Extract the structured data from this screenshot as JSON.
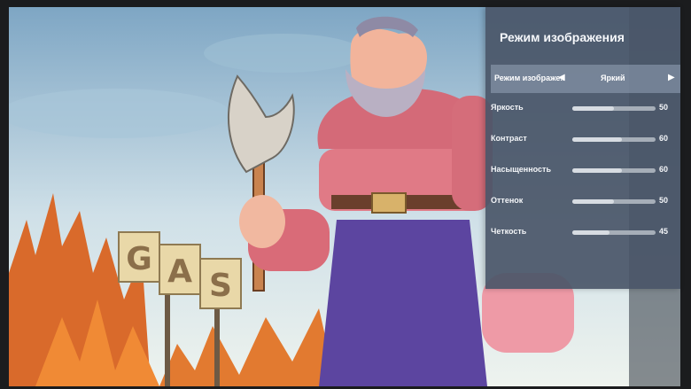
{
  "menu": {
    "title": "Режим изображения",
    "mode": {
      "label": "Режим изображе..",
      "value": "Яркий",
      "left_arrow": "◀",
      "right_arrow": "▶"
    },
    "settings": [
      {
        "label": "Яркость",
        "value": "50",
        "level": 0.5
      },
      {
        "label": "Контраст",
        "value": "60",
        "level": 0.6
      },
      {
        "label": "Насыщенность",
        "value": "60",
        "level": 0.6
      },
      {
        "label": "Оттенок",
        "value": "50",
        "level": 0.5
      },
      {
        "label": "Четкость",
        "value": "45",
        "level": 0.45
      }
    ]
  },
  "artwork": {
    "sign_letters": [
      "G",
      "A",
      "S"
    ]
  },
  "colors": {
    "panel": "#4a5668",
    "slider_track": "#a6aeb8",
    "slider_fill": "#d7dce2"
  }
}
